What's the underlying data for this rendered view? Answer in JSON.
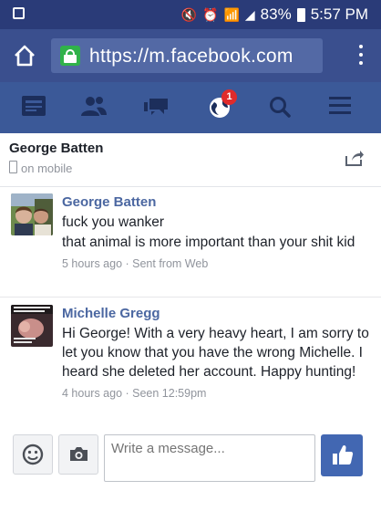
{
  "status_bar": {
    "battery": "83%",
    "time": "5:57 PM"
  },
  "address_bar": {
    "url": "https://m.facebook.com"
  },
  "nav": {
    "notification_count": "1"
  },
  "thread": {
    "contact_name": "George Batten",
    "contact_status": "on mobile"
  },
  "messages": [
    {
      "sender": "George Batten",
      "lines": [
        "fuck you wanker",
        "that animal is more important than your shit kid"
      ],
      "meta": "5 hours ago · Sent from Web"
    },
    {
      "sender": "Michelle Gregg",
      "lines": [
        "Hi George! With a very heavy heart, I am sorry to let you know that you have the wrong Michelle. I heard she deleted her account. Happy hunting!"
      ],
      "meta": "4 hours ago · Seen 12:59pm"
    }
  ],
  "composer": {
    "placeholder": "Write a message..."
  },
  "colors": {
    "status_bar": "#2a3b78",
    "address_bar": "#3a4f8e",
    "nav_bar": "#3b5998",
    "nav_icon": "#1c2e5b",
    "sender_name": "#4b67a1",
    "lock_green": "#30b24a",
    "badge_red": "#e02b2b",
    "like_button": "#4267b2"
  }
}
